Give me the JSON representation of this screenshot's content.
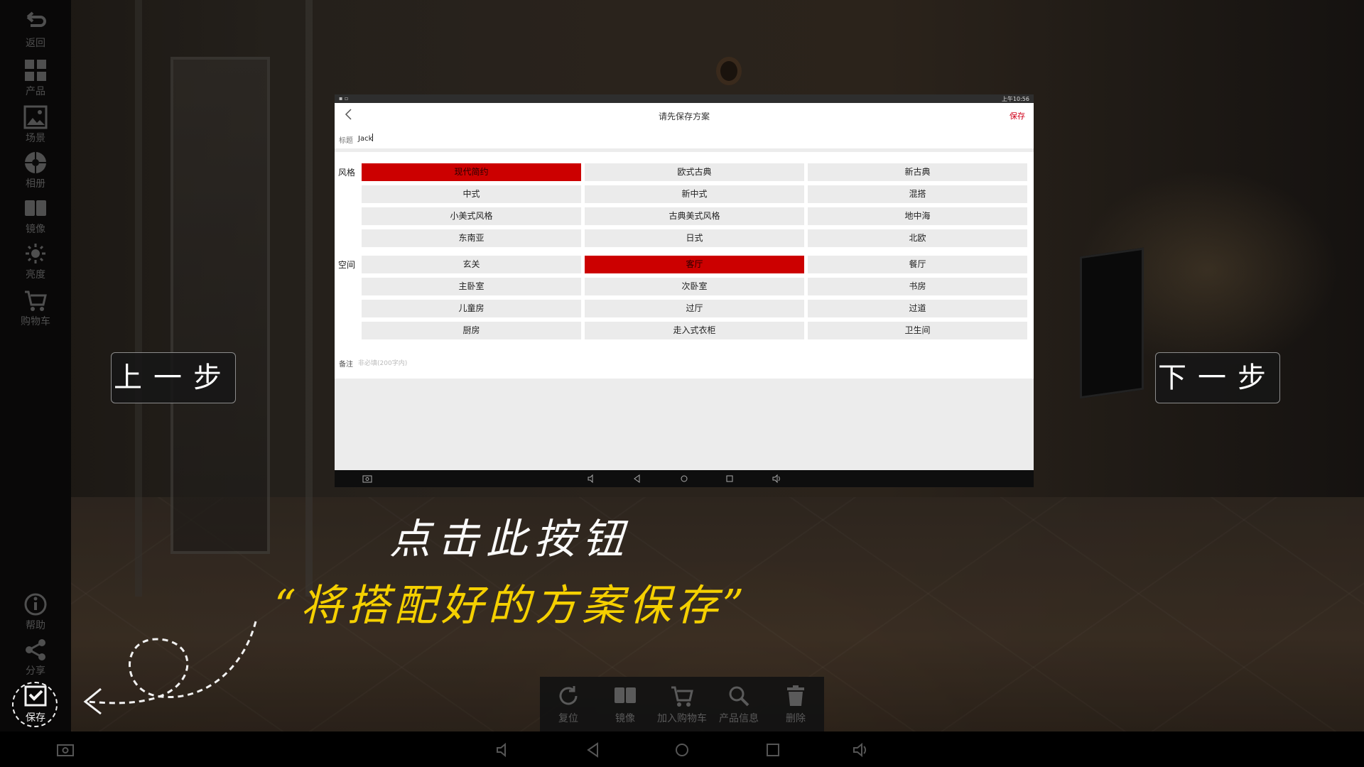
{
  "left_toolbar": {
    "items": [
      {
        "label": "返回",
        "icon": "return-icon"
      },
      {
        "label": "产品",
        "icon": "grid-icon"
      },
      {
        "label": "场景",
        "icon": "image-icon"
      },
      {
        "label": "相册",
        "icon": "aperture-icon"
      },
      {
        "label": "镜像",
        "icon": "book-icon"
      },
      {
        "label": "亮度",
        "icon": "sun-icon"
      },
      {
        "label": "购物车",
        "icon": "cart-icon"
      },
      {
        "label": "帮助",
        "icon": "info-icon"
      },
      {
        "label": "分享",
        "icon": "share-icon"
      },
      {
        "label": "保存",
        "icon": "save-check-icon"
      }
    ]
  },
  "overlay": {
    "prev_label": "上一步",
    "next_label": "下一步",
    "hint_line1": "点击此按钮",
    "hint_line2": "“将搭配好的方案保存”"
  },
  "device": {
    "status_time": "上午10:56",
    "header_title": "请先保存方案",
    "header_save": "保存",
    "title_label": "标题",
    "title_value": "Jack",
    "style_label": "风格",
    "style_options": [
      "现代简约",
      "欧式古典",
      "新古典",
      "中式",
      "新中式",
      "混搭",
      "小美式风格",
      "古典美式风格",
      "地中海",
      "东南亚",
      "日式",
      "北欧"
    ],
    "style_selected": "现代简约",
    "space_label": "空间",
    "space_options": [
      "玄关",
      "客厅",
      "餐厅",
      "主卧室",
      "次卧室",
      "书房",
      "儿童房",
      "过厅",
      "过道",
      "厨房",
      "走入式衣柜",
      "卫生间"
    ],
    "space_selected": "客厅",
    "note_label": "备注",
    "note_placeholder": "非必填(200字内)"
  },
  "bottom_bar": {
    "items": [
      {
        "label": "复位",
        "icon": "reset-icon"
      },
      {
        "label": "镜像",
        "icon": "mirror-book-icon"
      },
      {
        "label": "加入购物车",
        "icon": "cart-icon"
      },
      {
        "label": "产品信息",
        "icon": "search-icon"
      },
      {
        "label": "删除",
        "icon": "trash-icon"
      }
    ]
  },
  "colors": {
    "accent_red": "#cc0000",
    "hint_yellow": "#f5d000"
  }
}
